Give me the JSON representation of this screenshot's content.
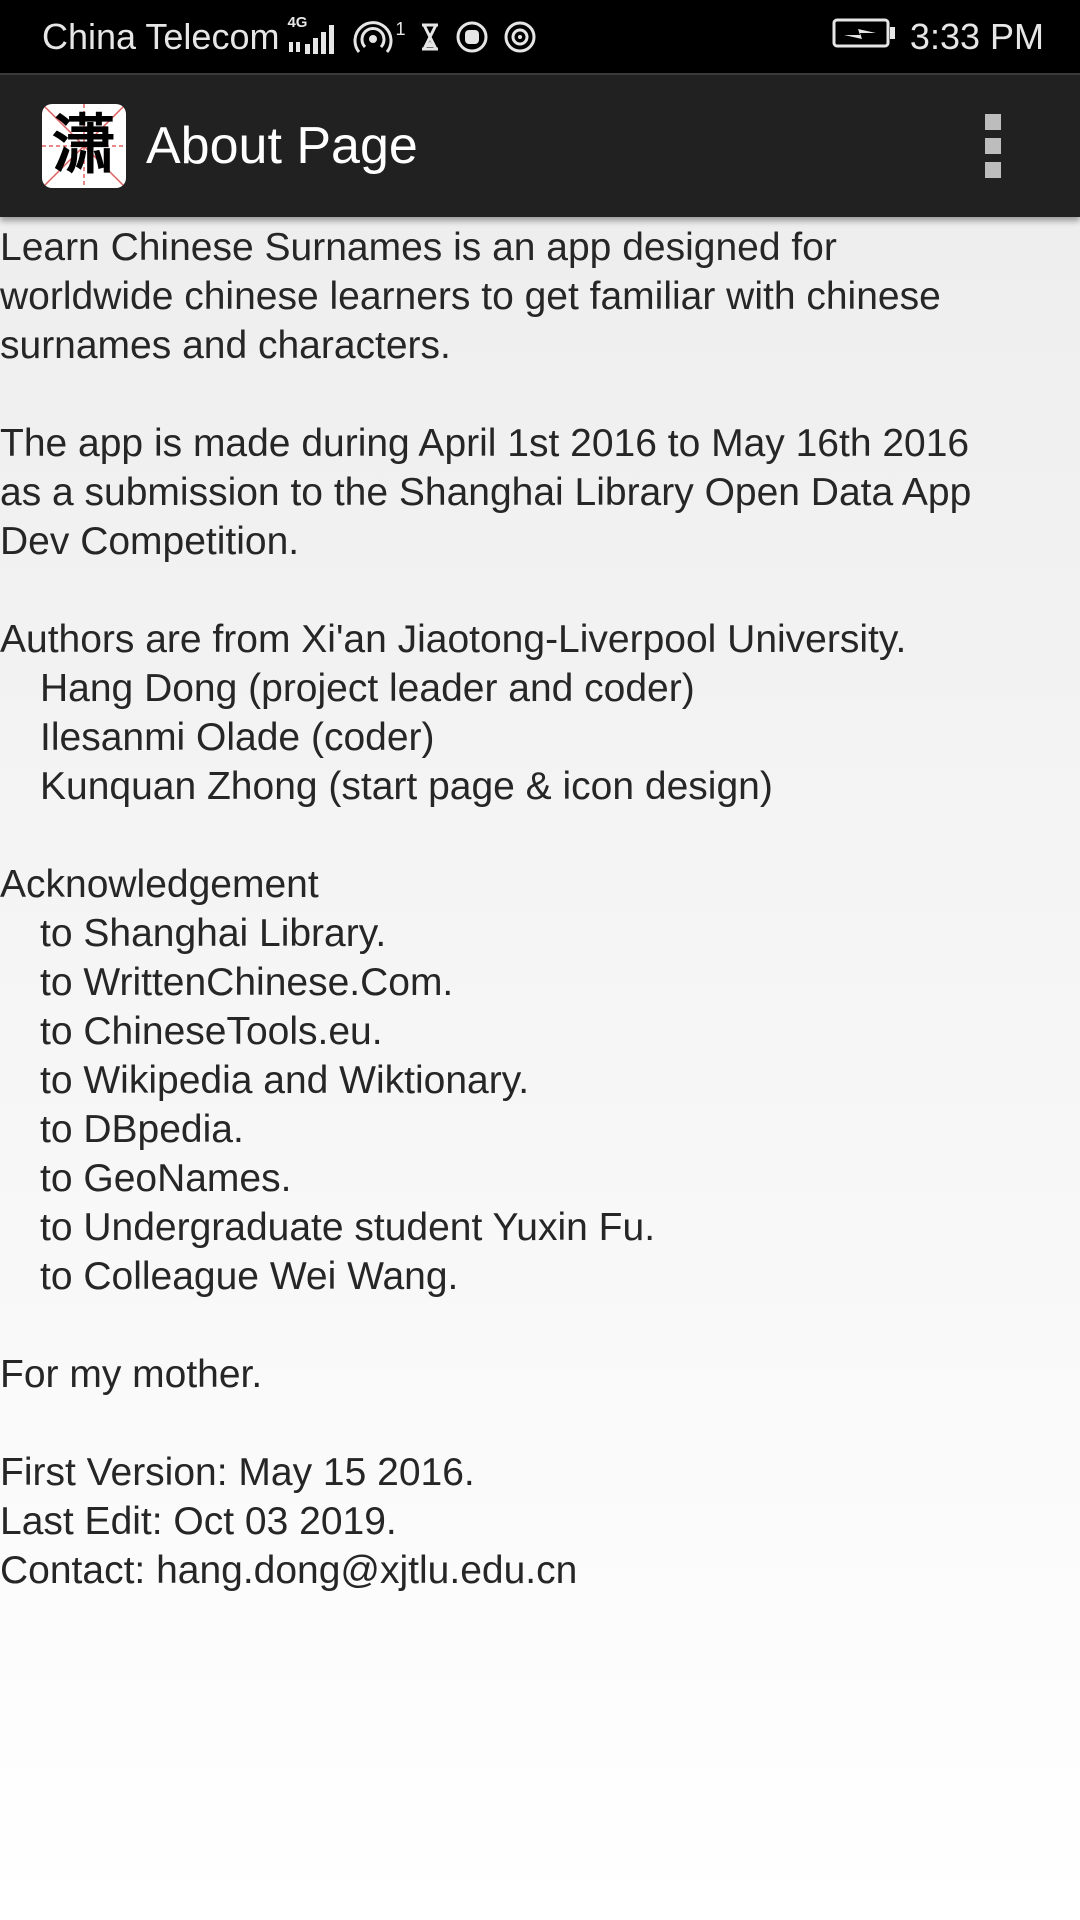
{
  "status_bar": {
    "carrier": "China Telecom",
    "network_badge": "4G",
    "hotspot_count": "1",
    "time": "3:33 PM",
    "icons": [
      "signal-icon",
      "hotspot-icon",
      "hourglass-icon",
      "hand-icon",
      "nfc-icon",
      "battery-charging-icon"
    ]
  },
  "app_bar": {
    "icon_glyph": "潇",
    "title": "About Page",
    "menu_icon": "overflow-menu-icon"
  },
  "about": {
    "intro": [
      "Learn Chinese Surnames is an app designed for",
      "worldwide chinese learners to get familiar with chinese",
      "surnames and characters."
    ],
    "made": [
      "The app is made during April 1st 2016 to May 16th 2016",
      "as a submission to the Shanghai Library Open Data App",
      "Dev Competition."
    ],
    "authors_heading": "Authors are from Xi'an Jiaotong-Liverpool University.",
    "authors": [
      "Hang Dong (project leader and coder)",
      "Ilesanmi Olade (coder)",
      "Kunquan Zhong (start page & icon design)"
    ],
    "ack_heading": "Acknowledgement",
    "acknowledgements": [
      "to Shanghai Library.",
      "to WrittenChinese.Com.",
      "to ChineseTools.eu.",
      "to Wikipedia and Wiktionary.",
      "to DBpedia.",
      "to GeoNames.",
      "to Undergraduate student Yuxin Fu.",
      "to Colleague Wei Wang."
    ],
    "dedication": "For my mother.",
    "first_version": "First Version: May 15 2016.",
    "last_edit": "Last Edit: Oct 03 2019.",
    "contact": "Contact: hang.dong@xjtlu.edu.cn"
  }
}
